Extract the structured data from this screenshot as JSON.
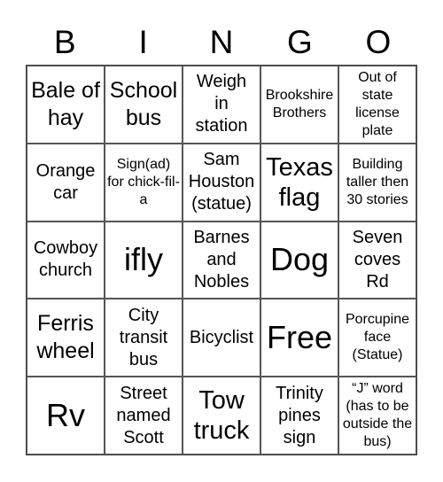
{
  "header": [
    "B",
    "I",
    "N",
    "G",
    "O"
  ],
  "cells": [
    "Bale of hay",
    "School bus",
    "Weigh in station",
    "Brookshire Brothers",
    "Out of state license plate",
    "Orange car",
    "Sign(ad) for chick-fil-a",
    "Sam Houston (statue)",
    "Texas flag",
    "Building taller then 30 stories",
    "Cowboy church",
    "ifly",
    "Barnes and Nobles",
    "Dog",
    "Seven coves Rd",
    "Ferris wheel",
    "City transit bus",
    "Bicyclist",
    "Free",
    "Porcupine face (Statue)",
    "Rv",
    "Street named Scott",
    "Tow truck",
    "Trinity pines sign",
    "“J” word (has to be outside the bus)"
  ]
}
